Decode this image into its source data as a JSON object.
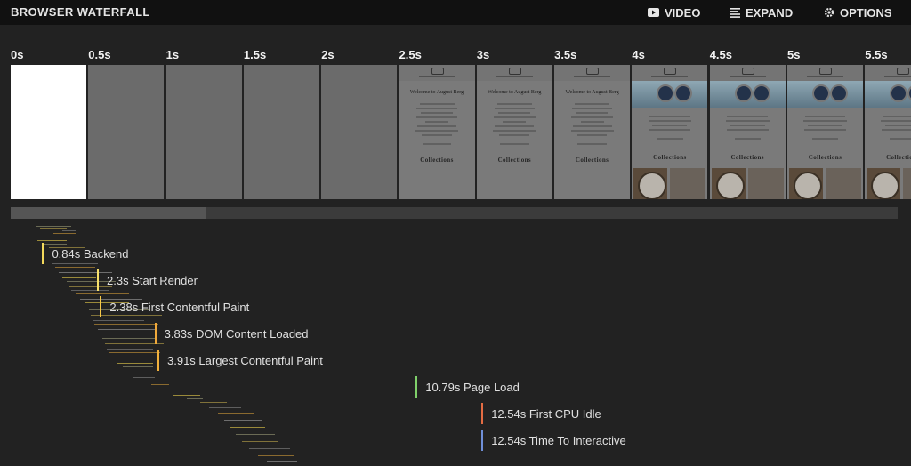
{
  "header": {
    "title": "BROWSER WATERFALL",
    "video_label": "VIDEO",
    "expand_label": "EXPAND",
    "options_label": "OPTIONS"
  },
  "timeline": {
    "ticks": [
      "0s",
      "0.5s",
      "1s",
      "1.5s",
      "2s",
      "2.5s",
      "3s",
      "3.5s",
      "4s",
      "4.5s",
      "5s",
      "5.5s"
    ]
  },
  "frames": [
    {
      "type": "white"
    },
    {
      "type": "blank"
    },
    {
      "type": "blank"
    },
    {
      "type": "blank"
    },
    {
      "type": "blank"
    },
    {
      "type": "text"
    },
    {
      "type": "text"
    },
    {
      "type": "text"
    },
    {
      "type": "image"
    },
    {
      "type": "image"
    },
    {
      "type": "image"
    },
    {
      "type": "image"
    }
  ],
  "frame_text": {
    "heading": "Welcome to August Berg",
    "collections": "Collections"
  },
  "scroll": {
    "visible_fraction": 0.22
  },
  "markers": [
    {
      "time": 0.84,
      "label": "0.84s Backend",
      "color": "#f3d95b"
    },
    {
      "time": 2.3,
      "label": "2.3s Start Render",
      "color": "#f7e06a"
    },
    {
      "time": 2.38,
      "label": "2.38s First Contentful Paint",
      "color": "#f7c948"
    },
    {
      "time": 3.83,
      "label": "3.83s DOM Content Loaded",
      "color": "#f0a93a"
    },
    {
      "time": 3.91,
      "label": "3.91s Largest Contentful Paint",
      "color": "#f1b13c"
    },
    {
      "time": 10.79,
      "label": "10.79s Page Load",
      "color": "#7fd06a"
    },
    {
      "time": 12.54,
      "label": "12.54s First CPU Idle",
      "color": "#e46c43"
    },
    {
      "time": 12.54,
      "label": "12.54s Time To Interactive",
      "color": "#6f8fd8"
    }
  ],
  "colors": {
    "background": "#222222",
    "topbar": "#111111",
    "request_palette": [
      "#6b6b55",
      "#80723a",
      "#5e5e5e",
      "#8a6a2f",
      "#6e6e6e",
      "#9a8a3a"
    ]
  }
}
